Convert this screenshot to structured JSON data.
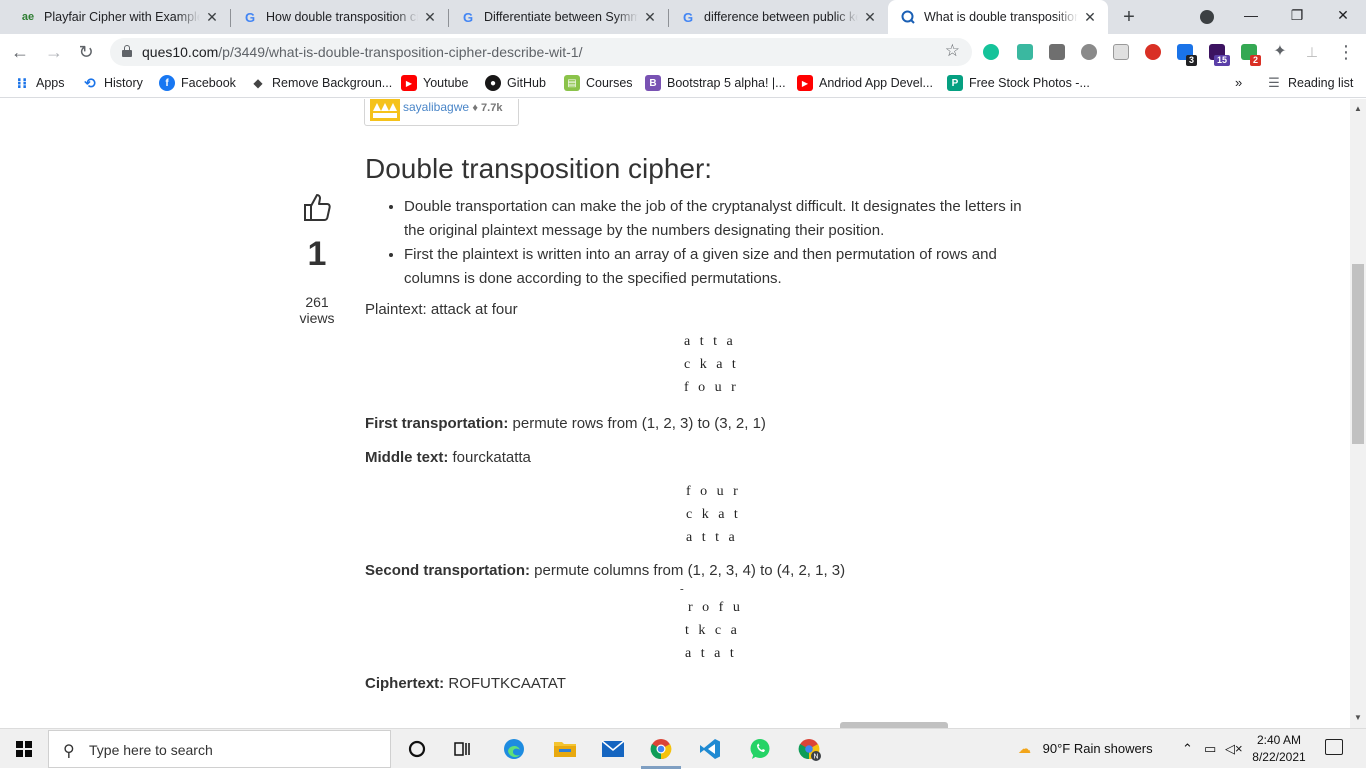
{
  "tabs": [
    {
      "title": "Playfair Cipher with Examples",
      "icon": "playfair-favicon",
      "active": false
    },
    {
      "title": "How double transposition cip",
      "icon": "google-g-icon",
      "active": false
    },
    {
      "title": "Differentiate between Symme",
      "icon": "google-g-icon",
      "active": false
    },
    {
      "title": "difference between public key",
      "icon": "google-g-icon",
      "active": false
    },
    {
      "title": "What is double transposition",
      "icon": "ques10-favicon",
      "active": true
    }
  ],
  "tab_close_glyph": "✕",
  "new_tab_glyph": "+",
  "window_controls": {
    "minimize": "—",
    "restore": "❐",
    "close": "✕"
  },
  "address": {
    "host": "ques10.com",
    "path": "/p/3449/what-is-double-transposition-cipher-describe-wit-1/"
  },
  "extension_badges": [
    "3",
    "15",
    "2"
  ],
  "bookmarks": [
    {
      "label": "Apps",
      "icon": "apps-grid-icon",
      "color": "#1a73e8"
    },
    {
      "label": "History",
      "icon": "history-icon",
      "color": "#1a73e8"
    },
    {
      "label": "Facebook",
      "icon": "facebook-icon",
      "color": "#1877f2"
    },
    {
      "label": "Remove Backgroun...",
      "icon": "remove-bg-icon",
      "color": "#444444"
    },
    {
      "label": "Youtube",
      "icon": "youtube-icon",
      "color": "#ff0000"
    },
    {
      "label": "GitHub",
      "icon": "github-icon",
      "color": "#181717"
    },
    {
      "label": "Courses",
      "icon": "courses-icon",
      "color": "#8bc34a"
    },
    {
      "label": "Bootstrap 5 alpha! |...",
      "icon": "bootstrap-icon",
      "color": "#7952b3"
    },
    {
      "label": "Andriod App Devel...",
      "icon": "youtube-icon",
      "color": "#ff0000"
    },
    {
      "label": "Free Stock Photos -...",
      "icon": "pexels-icon",
      "color": "#05a081"
    }
  ],
  "bookmarks_overflow": "»",
  "reading_list": "Reading list",
  "author": {
    "name": "sayalibagwe",
    "rep": "♦ 7.7k"
  },
  "post": {
    "heading": "Double transposition cipher:",
    "votes": "1",
    "views_number": "261",
    "views_label": "views",
    "bullets": [
      "Double transportation can make the job of the cryptanalyst difficult. It designates the letters in the original plaintext message by the numbers designating their position.",
      "First the plaintext is written into an array of a given size and then permutation of rows and columns is done according to the specified permutations."
    ],
    "plaintext": "Plaintext: attack at four",
    "matrix1": [
      "a t t a",
      "c k a t",
      "f o u r"
    ],
    "first_label": "First transportation:",
    "first_text": " permute rows from (1, 2, 3) to (3, 2, 1)",
    "middle_label": "Middle text:",
    "middle_text": " fourckatatta",
    "matrix2": [
      "f o u r",
      "c k a t",
      "a t t a"
    ],
    "second_label": "Second transportation:",
    "second_text": " permute columns from (1, 2, 3, 4) to (4, 2, 1, 3)",
    "matrix3_mark": "-",
    "matrix3": [
      "r o f u",
      "t k c a",
      "a t a t"
    ],
    "cipher_label": "Ciphertext:",
    "cipher_text": " ROFUTKCAATAT"
  },
  "taskbar": {
    "search_placeholder": "Type here to search",
    "weather": "90°F  Rain showers",
    "time": "2:40 AM",
    "date": "8/22/2021"
  }
}
